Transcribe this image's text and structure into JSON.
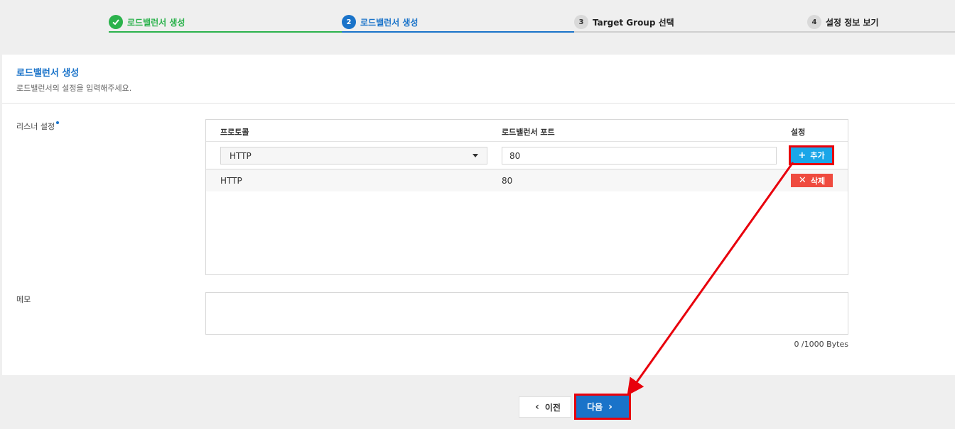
{
  "stepper": {
    "steps": [
      {
        "num": "",
        "label": "로드밸런서 생성",
        "state": "done"
      },
      {
        "num": "2",
        "label": "로드밸런서 생성",
        "state": "active"
      },
      {
        "num": "3",
        "label": "Target Group 선택",
        "state": "pending"
      },
      {
        "num": "4",
        "label": "설정 정보 보기",
        "state": "pending"
      }
    ]
  },
  "panel": {
    "title": "로드밸런서 생성",
    "description": "로드밸런서의 설정을 입력해주세요."
  },
  "listener": {
    "label": "리스너 설정",
    "columns": [
      "프로토콜",
      "로드밸런서 포트",
      "설정"
    ],
    "protocol_value": "HTTP",
    "port_value": "80",
    "add_label": "추가",
    "rows": [
      {
        "protocol": "HTTP",
        "port": "80",
        "delete_label": "삭제"
      }
    ]
  },
  "memo": {
    "label": "메모",
    "counter": "0 /1000 Bytes"
  },
  "footer": {
    "prev_label": "이전",
    "next_label": "다음"
  },
  "colors": {
    "done": "#2bb24c",
    "active": "#1a73c9",
    "add_button": "#1aa6e8",
    "delete_button": "#ef4b3f",
    "annotation": "#e8000c"
  }
}
